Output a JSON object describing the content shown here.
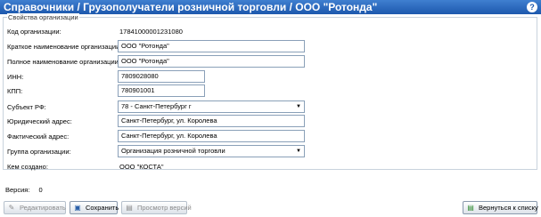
{
  "header": {
    "title": "Справочники / Грузополучатели розничной торговли / ООО \"Ротонда\""
  },
  "form": {
    "legend": "Свойства организации",
    "code_label": "Код организации:",
    "code_value": "17841000001231080",
    "short_name_label": "Краткое наименование организации:",
    "short_name_value": "ООО \"Ротонда\"",
    "full_name_label": "Полное наименование организации:",
    "full_name_value": "ООО \"Ротонда\"",
    "inn_label": "ИНН:",
    "inn_value": "7809028080",
    "kpp_label": "КПП:",
    "kpp_value": "780901001",
    "subject_label": "Субъект РФ:",
    "subject_value": "78 - Санкт-Петербург г",
    "legal_address_label": "Юридический адрес:",
    "legal_address_value": "Санкт-Петербург, ул. Королева",
    "actual_address_label": "Фактический адрес:",
    "actual_address_value": "Санкт-Петербург, ул. Королева",
    "group_label": "Группа организации:",
    "group_value": "Организация розничной торговли",
    "created_by_label": "Кем создано:",
    "created_by_value": "ООО \"КОСТА\""
  },
  "version": {
    "label": "Версия:",
    "value": "0"
  },
  "buttons": {
    "edit": "Редактировать",
    "save": "Сохранить",
    "view_versions": "Просмотр версий",
    "back": "Вернуться к списку"
  },
  "icons": {
    "help": "help-icon",
    "edit": "pencil-icon",
    "save": "disk-icon",
    "versions": "document-icon",
    "back": "list-back-icon"
  },
  "colors": {
    "header": "#1d58ad",
    "border": "#8aa0b8"
  }
}
